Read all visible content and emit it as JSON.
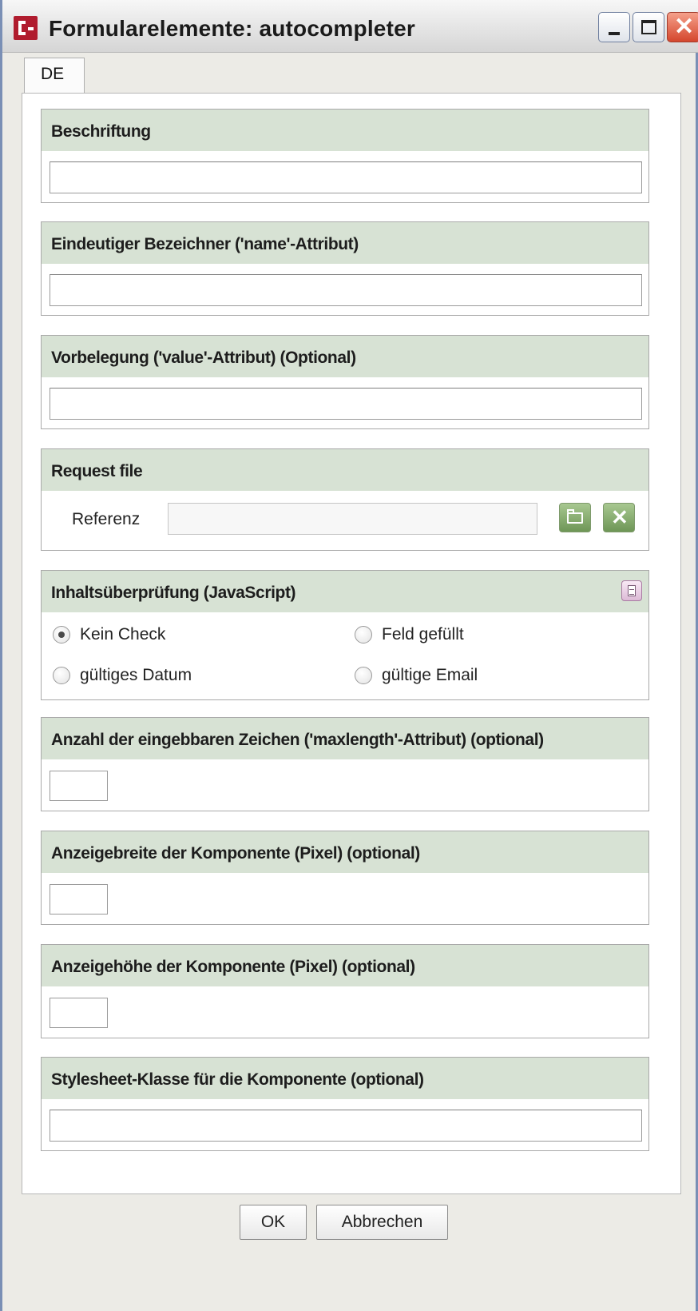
{
  "window": {
    "title": "Formularelemente: autocompleter",
    "controls": [
      "minimize-icon",
      "maximize-icon",
      "close-icon"
    ]
  },
  "tabs": [
    {
      "label": "DE",
      "selected": true
    }
  ],
  "sections": {
    "label": {
      "heading": "Beschriftung",
      "value": ""
    },
    "name": {
      "heading": "Eindeutiger Bezeichner ('name'-Attribut)",
      "value": ""
    },
    "value": {
      "heading": "Vorbelegung ('value'-Attribut) (Optional)",
      "value": ""
    },
    "request_file": {
      "heading": "Request file",
      "reference_label": "Referenz",
      "reference_value": "",
      "icons": [
        "open-folder-icon",
        "clear-icon"
      ]
    },
    "validation": {
      "heading": "Inhaltsüberprüfung (JavaScript)",
      "icon": "document-icon",
      "options": [
        {
          "label": "Kein Check",
          "checked": true
        },
        {
          "label": "Feld gefüllt",
          "checked": false
        },
        {
          "label": "gültiges Datum",
          "checked": false
        },
        {
          "label": "gültige Email",
          "checked": false
        }
      ]
    },
    "maxlength": {
      "heading": "Anzahl der eingebbaren Zeichen ('maxlength'-Attribut) (optional)",
      "value": ""
    },
    "width": {
      "heading": "Anzeigebreite der Komponente (Pixel) (optional)",
      "value": ""
    },
    "height": {
      "heading": "Anzeigehöhe der Komponente (Pixel) (optional)",
      "value": ""
    },
    "css_class": {
      "heading": "Stylesheet-Klasse für die Komponente (optional)",
      "value": ""
    }
  },
  "buttons": {
    "ok": "OK",
    "cancel": "Abbrechen"
  },
  "colors": {
    "panel_header": "#d7e2d4",
    "window_bg": "#ecebe6",
    "close_button": "#d4462d"
  }
}
